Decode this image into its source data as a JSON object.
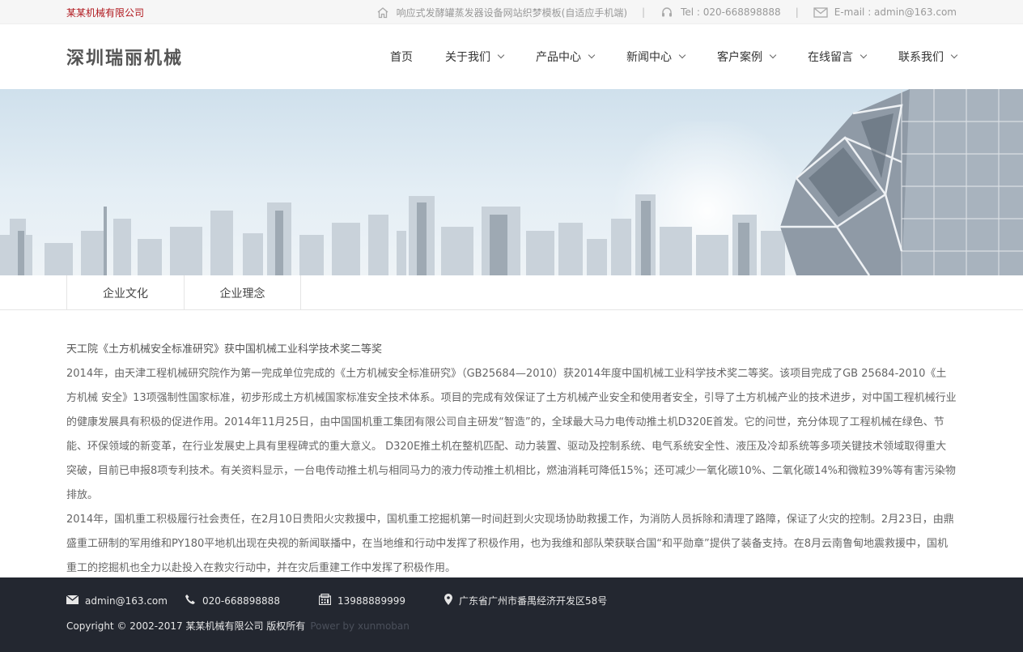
{
  "topbar": {
    "company": "某某机械有限公司",
    "template_name": "响应式发酵罐蒸发器设备网站织梦模板(自适应手机端)",
    "tel": "Tel : 020-668898888",
    "email": "E-mail : admin@163.com",
    "separator": "|"
  },
  "header": {
    "logo_text": "深圳瑞丽机械",
    "nav": [
      {
        "label": "首页",
        "has_dropdown": false
      },
      {
        "label": "关于我们",
        "has_dropdown": true
      },
      {
        "label": "产品中心",
        "has_dropdown": true
      },
      {
        "label": "新闻中心",
        "has_dropdown": true
      },
      {
        "label": "客户案例",
        "has_dropdown": true
      },
      {
        "label": "在线留言",
        "has_dropdown": true
      },
      {
        "label": "联系我们",
        "has_dropdown": true
      }
    ]
  },
  "subnav": {
    "tabs": [
      "企业文化",
      "企业理念"
    ]
  },
  "content": {
    "title": "天工院《土方机械安全标准研究》获中国机械工业科学技术奖二等奖",
    "paragraph1": "2014年，由天津工程机械研究院作为第一完成单位完成的《土方机械安全标准研究》（GB25684—2010）获2014年度中国机械工业科学技术奖二等奖。该项目完成了GB 25684-2010《土方机械 安全》13项强制性国家标准，初步形成土方机械国家标准安全技术体系。项目的完成有效保证了土方机械产业安全和使用者安全，引导了土方机械产业的技术进步，对中国工程机械行业的健康发展具有积极的促进作用。2014年11月25日，由中国国机重工集团有限公司自主研发“智造”的，全球最大马力电传动推土机D320E首发。它的问世，充分体现了工程机械在绿色、节能、环保领域的新变革，在行业发展史上具有里程碑式的重大意义。 D320E推土机在整机匹配、动力装置、驱动及控制系统、电气系统安全性、液压及冷却系统等多项关键技术领域取得重大突破，目前已申报8项专利技术。有关资料显示，一台电传动推土机与相同马力的液力传动推土机相比，燃油消耗可降低15%；还可减少一氧化碳10%、二氧化碳14%和微粒39%等有害污染物排放。",
    "paragraph2": "2014年，国机重工积极履行社会责任，在2月10日贵阳火灾救援中，国机重工挖掘机第一时间赶到火灾现场协助救援工作，为消防人员拆除和清理了路障，保证了火灾的控制。2月23日，由鼎盛重工研制的军用维和PY180平地机出现在央视的新闻联播中，在当地维和行动中发挥了积极作用，也为我维和部队荣获联合国“和平勋章”提供了装备支持。在8月云南鲁甸地震救援中，国机重工的挖掘机也全力以赴投入在救灾行动中，并在灾后重建工作中发挥了积极作用。"
  },
  "footer": {
    "email": "admin@163.com",
    "phone": "020-668898888",
    "mobile": "13988889999",
    "address": "广东省广州市番禺经济开发区58号",
    "copyright": "Copyright © 2002-2017 某某机械有限公司 版权所有",
    "powered": "Power by xunmoban"
  },
  "colors": {
    "brand_red": "#b0161c",
    "footer_bg": "#232730"
  }
}
